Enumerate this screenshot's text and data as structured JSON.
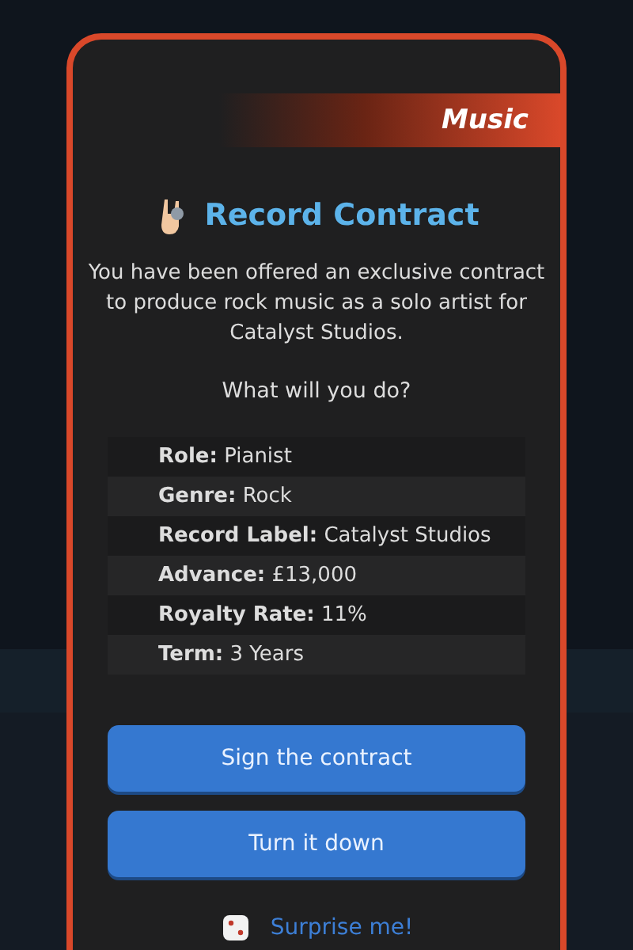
{
  "dialog": {
    "category": "Music",
    "title": "Record Contract",
    "message": "You have been offered an exclusive contract to produce rock music as a solo artist for Catalyst Studios.",
    "question": "What will you do?",
    "details": [
      {
        "label": "Role:",
        "value": "Pianist"
      },
      {
        "label": "Genre:",
        "value": "Rock"
      },
      {
        "label": "Record Label:",
        "value": "Catalyst Studios"
      },
      {
        "label": "Advance:",
        "value": "£13,000"
      },
      {
        "label": "Royalty Rate:",
        "value": "11%"
      },
      {
        "label": "Term:",
        "value": "3 Years"
      }
    ],
    "buttons": [
      "Sign the contract",
      "Turn it down"
    ],
    "surprise_link": "Surprise me!"
  }
}
